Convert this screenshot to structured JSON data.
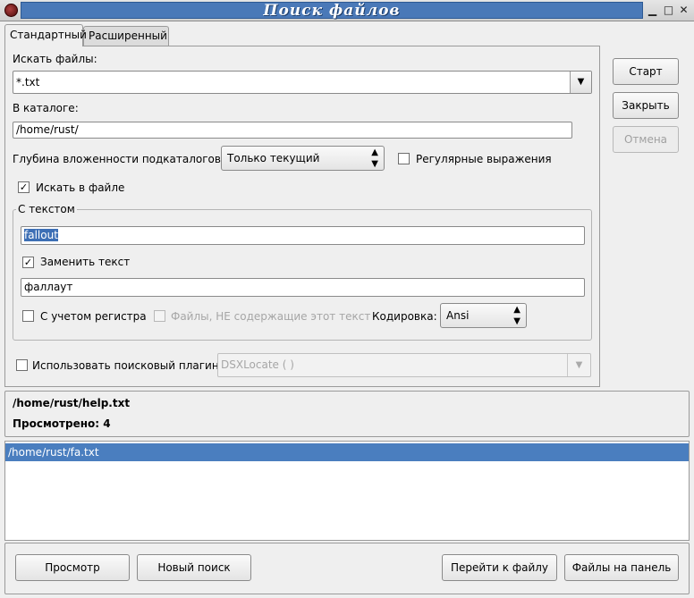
{
  "window": {
    "title": "Поиск файлов",
    "minimize_glyph": "▁",
    "maximize_glyph": "□",
    "close_glyph": "✕"
  },
  "tabs": [
    {
      "label": "Стандартный",
      "active": true
    },
    {
      "label": "Расширенный",
      "active": false
    }
  ],
  "search": {
    "files_label": "Искать файлы:",
    "files_value": "*.txt",
    "dir_label": "В каталоге:",
    "dir_value": "/home/rust/",
    "depth_label": "Глубина вложенности подкаталогов:",
    "depth_value": "Только текущий",
    "regex_label": "Регулярные выражения",
    "regex_checked": false,
    "search_in_file_label": "Искать в файле",
    "search_in_file_checked": true
  },
  "text_frame": {
    "legend": "С текстом",
    "search_text": "fallout",
    "replace_label": "Заменить текст",
    "replace_checked": true,
    "replace_value": "фаллаут",
    "case_label": "С учетом регистра",
    "case_checked": false,
    "not_containing_label": "Файлы, НЕ содержащие этот текст",
    "not_containing_checked": false,
    "encoding_label": "Кодировка:",
    "encoding_value": "Ansi"
  },
  "plugin": {
    "label": "Использовать поисковый плагин:",
    "checked": false,
    "value": "DSXLocate ( )"
  },
  "side_buttons": {
    "start": "Старт",
    "close": "Закрыть",
    "cancel": "Отмена"
  },
  "status": {
    "current_file": "/home/rust/help.txt",
    "scanned": "Просмотрено: 4"
  },
  "results": [
    "/home/rust/fa.txt"
  ],
  "bottom_buttons": {
    "view": "Просмотр",
    "new_search": "Новый поиск",
    "goto_file": "Перейти к файлу",
    "files_to_panel": "Файлы на панель"
  },
  "colors": {
    "title_bar": "#4a79b8",
    "selection": "#4a7ebf"
  }
}
